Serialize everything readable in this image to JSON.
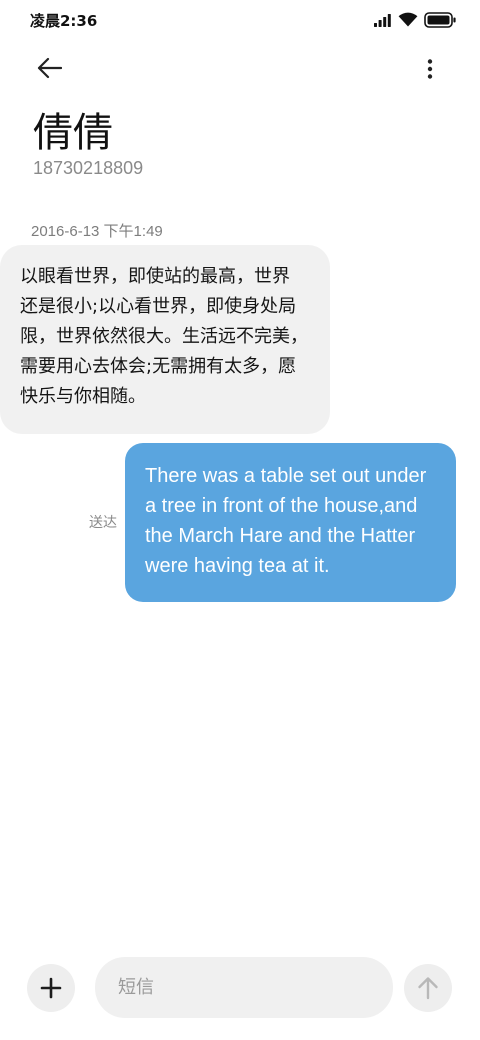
{
  "status_bar": {
    "time": "凌晨2:36",
    "signal_icon": "signal-icon",
    "wifi_icon": "wifi-icon",
    "battery_icon": "battery-icon"
  },
  "header": {
    "back_icon": "back-arrow-icon",
    "more_icon": "more-vertical-icon",
    "contact_name": "倩倩",
    "contact_number": "18730218809"
  },
  "conversation": {
    "timestamp": "2016-6-13 下午1:49",
    "received_message": {
      "lines": [
        "以眼看世界，即使站的最高，世界",
        "还是很小;以心看世界，即使身处局",
        "限，世界依然很大。生活远不完美，",
        "需要用心去体会;无需拥有太多，愿",
        "快乐与你相随。"
      ]
    },
    "sent_message": {
      "lines": [
        "There was a table set out under",
        "a tree in front of the house,and",
        "the March Hare and the Hatter",
        "were having tea at it."
      ],
      "status": "送达"
    }
  },
  "composer": {
    "add_icon": "plus-icon",
    "placeholder": "短信",
    "value": "",
    "send_icon": "send-arrow-up-icon"
  },
  "colors": {
    "background": "#ffffff",
    "received_bubble": "#f1f1f1",
    "sent_bubble": "#5aa5df",
    "secondary_text": "#8a8a8a"
  }
}
